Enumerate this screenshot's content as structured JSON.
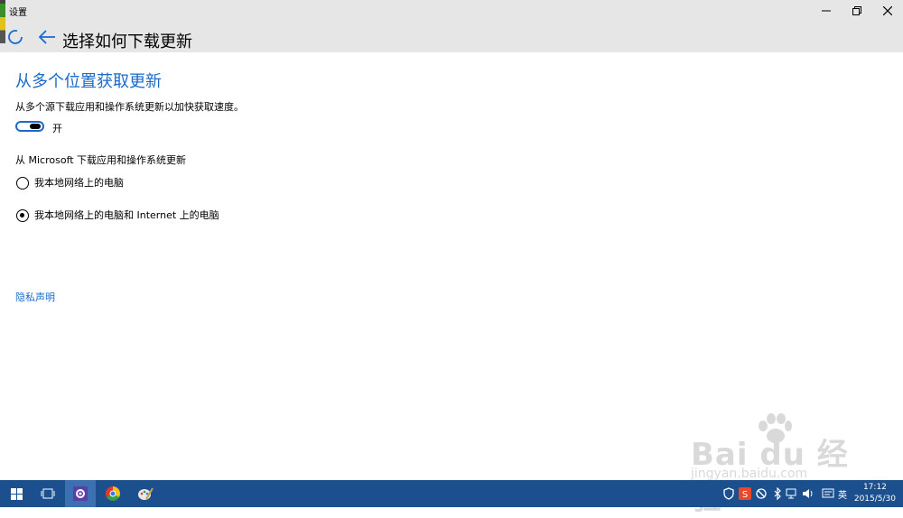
{
  "window": {
    "app_title": "设置",
    "page_title": "选择如何下载更新"
  },
  "content": {
    "section_title": "从多个位置获取更新",
    "description": "从多个源下载应用和操作系统更新以加快获取速度。",
    "toggle": {
      "state_label": "开",
      "on": true
    },
    "sub_heading": "从 Microsoft 下载应用和操作系统更新",
    "options": [
      {
        "label": "我本地网络上的电脑",
        "selected": false
      },
      {
        "label": "我本地网络上的电脑和 Internet 上的电脑",
        "selected": true
      }
    ],
    "privacy_link": "隐私声明"
  },
  "watermark": {
    "brand": "Bai du 经验",
    "url": "jingyan.baidu.com"
  },
  "taskbar": {
    "clock_time": "17:12",
    "clock_date": "2015/5/30",
    "ime_label": "英"
  },
  "colors": {
    "accent": "#1b6ac9",
    "titlebar": "#e6e6e6",
    "taskbar": "#1b4f8e"
  }
}
